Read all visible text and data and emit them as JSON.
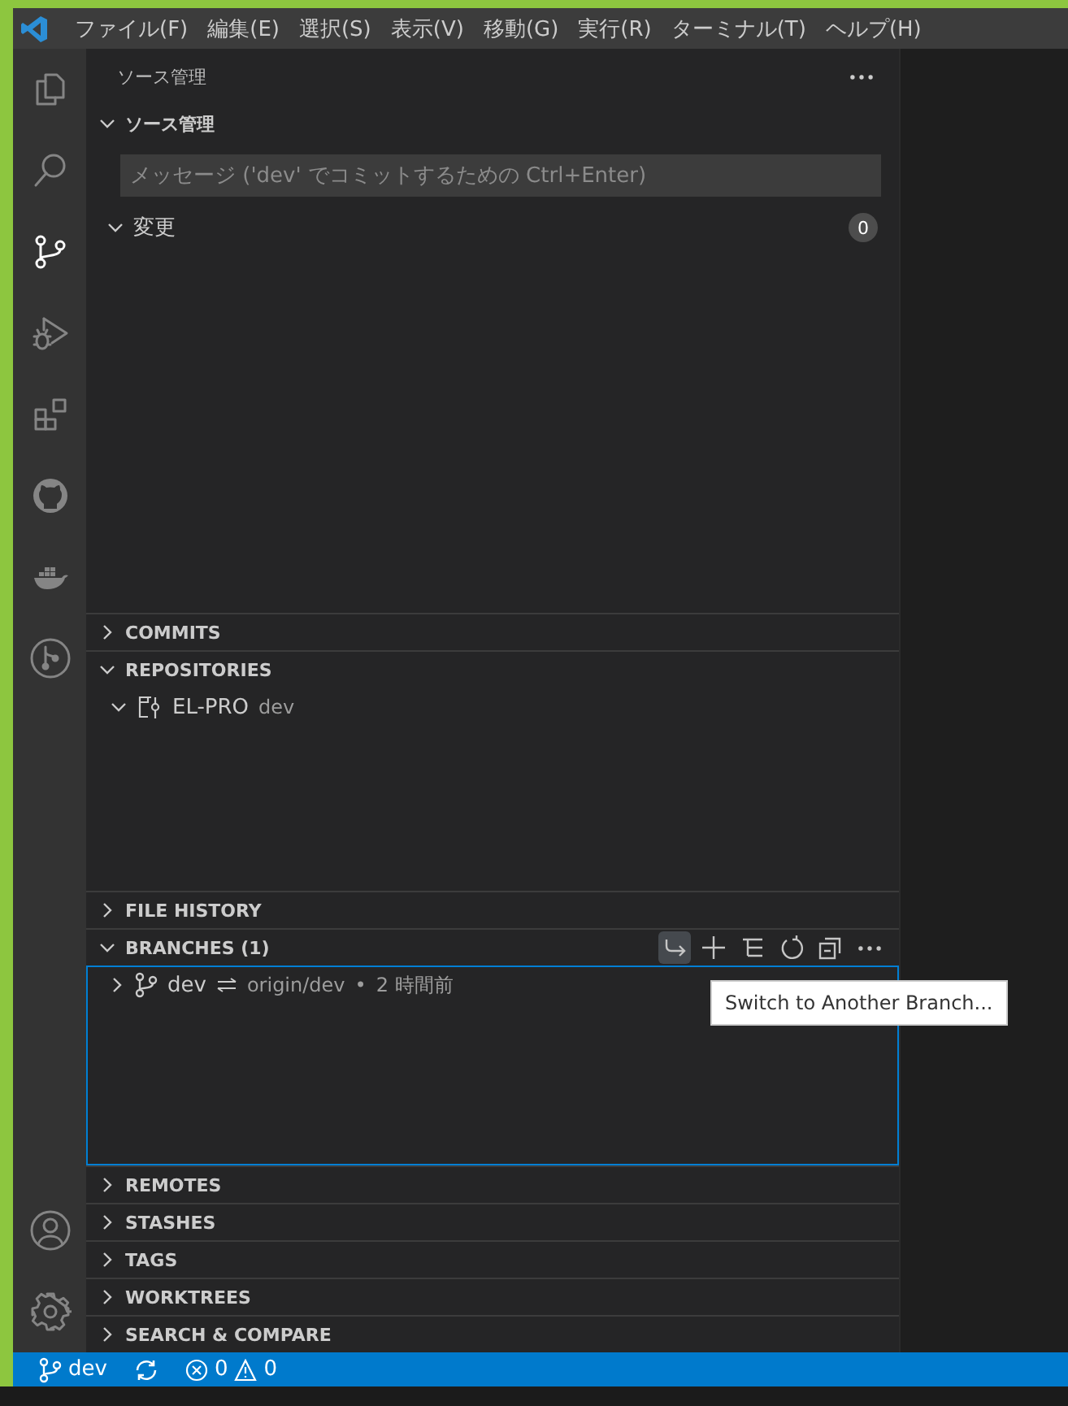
{
  "menu": [
    {
      "label": "ファイル(F)"
    },
    {
      "label": "編集(E)"
    },
    {
      "label": "選択(S)"
    },
    {
      "label": "表示(V)"
    },
    {
      "label": "移動(G)"
    },
    {
      "label": "実行(R)"
    },
    {
      "label": "ターミナル(T)"
    },
    {
      "label": "ヘルプ(H)"
    }
  ],
  "activity_bar": [
    {
      "kind": "explorer",
      "selected": false
    },
    {
      "kind": "search",
      "selected": false
    },
    {
      "kind": "source-control",
      "selected": true
    },
    {
      "kind": "run-debug",
      "selected": false
    },
    {
      "kind": "extensions",
      "selected": false
    },
    {
      "kind": "github",
      "selected": false
    },
    {
      "kind": "docker",
      "selected": false
    },
    {
      "kind": "git-graph",
      "selected": false
    }
  ],
  "activity_bar_bottom": [
    {
      "kind": "account"
    },
    {
      "kind": "settings"
    }
  ],
  "sidebar": {
    "title": "ソース管理",
    "sections": [
      {
        "kind": "scm",
        "title": "ソース管理",
        "expanded": true,
        "message": {
          "placeholder": "メッセージ ('dev' でコミットするための Ctrl+Enter)"
        },
        "groups": [
          {
            "label": "変更",
            "expanded": true,
            "count": "0"
          }
        ]
      },
      {
        "kind": "plain",
        "title": "COMMITS",
        "expanded": false
      },
      {
        "kind": "repositories",
        "title": "REPOSITORIES",
        "expanded": true,
        "items": [
          {
            "name": "EL-PRO",
            "branch": "dev",
            "expanded": true
          }
        ]
      },
      {
        "kind": "plain",
        "title": "FILE HISTORY",
        "expanded": false
      },
      {
        "kind": "branches",
        "title": "BRANCHES (1)",
        "expanded": true,
        "focused": true,
        "actions": [
          {
            "kind": "switch",
            "hovered": true
          },
          {
            "kind": "add",
            "hovered": false
          },
          {
            "kind": "list",
            "hovered": false
          },
          {
            "kind": "refresh",
            "hovered": false
          },
          {
            "kind": "collapse",
            "hovered": false
          },
          {
            "kind": "more",
            "hovered": false
          }
        ],
        "items": [
          {
            "name": "dev",
            "upstream": "origin/dev",
            "separator": "•",
            "time": "2 時間前",
            "expanded": false
          }
        ]
      },
      {
        "kind": "plain",
        "title": "REMOTES",
        "expanded": false
      },
      {
        "kind": "plain",
        "title": "STASHES",
        "expanded": false
      },
      {
        "kind": "plain",
        "title": "TAGS",
        "expanded": false
      },
      {
        "kind": "plain",
        "title": "WORKTREES",
        "expanded": false
      },
      {
        "kind": "plain",
        "title": "SEARCH & COMPARE",
        "expanded": false
      }
    ]
  },
  "tooltip": {
    "text": "Switch to Another Branch..."
  },
  "status_bar": {
    "branch": "dev",
    "errors": "0",
    "warnings": "0"
  }
}
